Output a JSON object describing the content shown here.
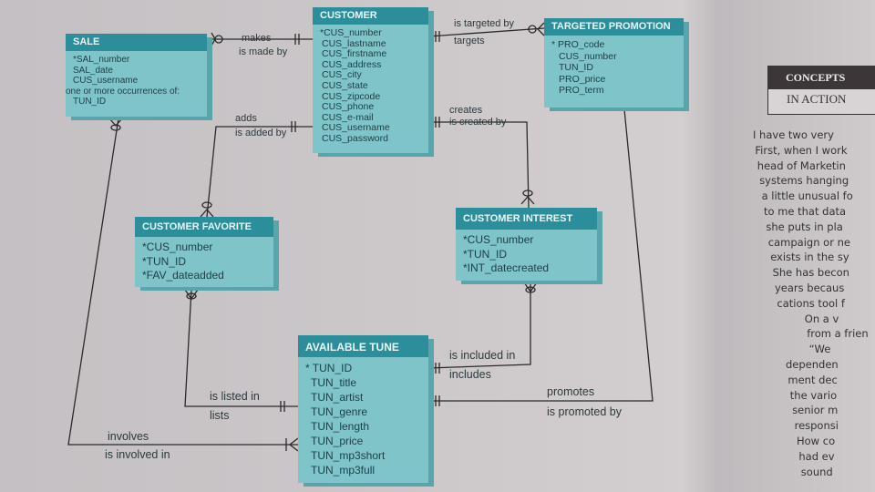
{
  "entities": {
    "sale": {
      "title": "SALE",
      "attrs": [
        "*SAL_number",
        "SAL_date",
        "CUS_username",
        "one or more occurrences of:",
        "TUN_ID"
      ]
    },
    "customer": {
      "title": "CUSTOMER",
      "attrs": [
        "*CUS_number",
        "CUS_lastname",
        "CUS_firstname",
        "CUS_address",
        "CUS_city",
        "CUS_state",
        "CUS_zipcode",
        "CUS_phone",
        "CUS_e-mail",
        "CUS_username",
        "CUS_password"
      ]
    },
    "promotion": {
      "title": "TARGETED PROMOTION",
      "attrs": [
        "* PRO_code",
        "CUS_number",
        "TUN_ID",
        "PRO_price",
        "PRO_term"
      ]
    },
    "favorite": {
      "title": "CUSTOMER FAVORITE",
      "attrs": [
        "*CUS_number",
        "*TUN_ID",
        "*FAV_dateadded"
      ]
    },
    "interest": {
      "title": "CUSTOMER INTEREST",
      "attrs": [
        "*CUS_number",
        "*TUN_ID",
        "*INT_datecreated"
      ]
    },
    "tune": {
      "title": "AVAILABLE TUNE",
      "attrs": [
        "* TUN_ID",
        "TUN_title",
        "TUN_artist",
        "TUN_genre",
        "TUN_length",
        "TUN_price",
        "TUN_mp3short",
        "TUN_mp3full"
      ]
    }
  },
  "relationships": {
    "makes": "makes",
    "is_made_by": "is made by",
    "is_targeted_by": "is targeted by",
    "targets": "targets",
    "adds": "adds",
    "is_added_by": "is added by",
    "creates": "creates",
    "is_created_by": "is created by",
    "is_listed_in": "is listed in",
    "lists": "lists",
    "is_included_in": "is included in",
    "includes": "includes",
    "promotes": "promotes",
    "is_promoted_by": "is promoted by",
    "involves": "involves",
    "is_involved_in": "is involved in"
  },
  "sidebar": {
    "title": "CONCEPTS",
    "subtitle": "IN ACTION",
    "lines": [
      "I have two very",
      "First, when I work",
      "head of Marketin",
      "systems hanging",
      "a little unusual fo",
      "to me that data",
      "she puts in pla",
      "campaign or ne",
      "exists in the sy",
      "She has becon",
      "years becaus",
      "cations tool f",
      "On a v",
      "from a frien",
      "“We",
      "dependen",
      "ment dec",
      "the vario",
      "senior m",
      "responsi",
      "How co",
      "had ev",
      "sound"
    ]
  },
  "colors": {
    "entity_header": "#2c8e9b",
    "entity_body": "#7ec4c9",
    "sidebar_header": "#3d3639"
  }
}
